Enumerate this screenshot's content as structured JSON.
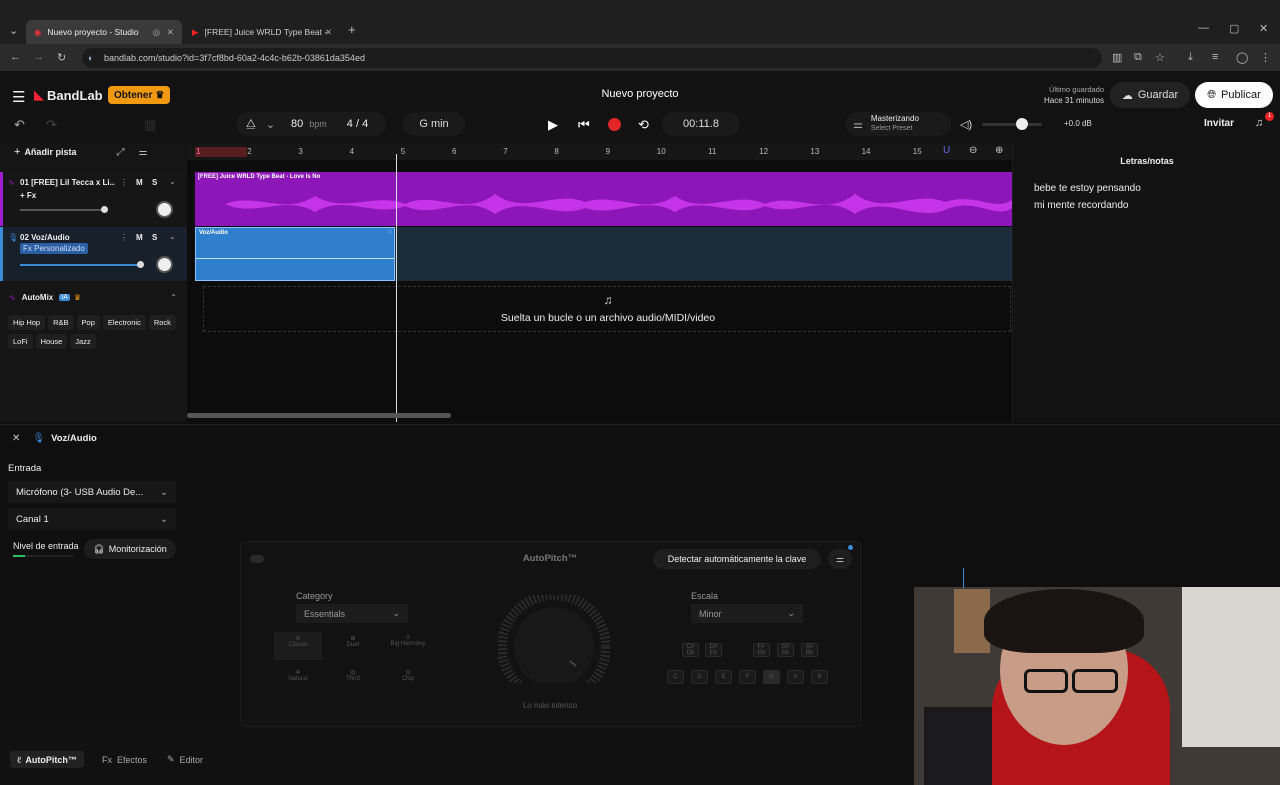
{
  "browser": {
    "tabs": [
      {
        "label": "Nuevo proyecto - Studio"
      },
      {
        "label": "[FREE] Juice WRLD Type Beat - "
      }
    ],
    "url": "bandlab.com/studio?id=3f7cf8bd-60a2-4c4c-b62b-03861da354ed"
  },
  "app": {
    "brand": "BandLab",
    "get_button": "Obtener",
    "project_title": "Nuevo proyecto",
    "tempo": "80",
    "tempo_unit": "bpm",
    "time_sig": "4 / 4",
    "key": "G min",
    "time": "00:11.8",
    "mastering_title": "Masterizando",
    "mastering_preset": "Select Preset",
    "volume_db": "+0.0 dB",
    "last_saved_label": "Último guardado",
    "last_saved_value": "Hace 31 minutos",
    "save_button": "Guardar",
    "publish_button": "Publicar",
    "invite_button": "Invitar",
    "notification_count": "1"
  },
  "tracks_panel": {
    "add_track": "Añadir pista",
    "tracks": [
      {
        "name": "01  [FREE] Lil Tecca x Li...",
        "fx": "+ Fx",
        "mute": "M",
        "solo": "S"
      },
      {
        "name": "02  Voz/Audio",
        "fx": "Fx Personalizado",
        "mute": "M",
        "solo": "S"
      }
    ],
    "automix_label": "AutoMix",
    "automix_badge": "IA",
    "genres_row1": [
      "Hip Hop",
      "R&B",
      "Pop",
      "Electronic",
      "Rock"
    ],
    "genres_row2": [
      "LoFi",
      "House",
      "Jazz"
    ]
  },
  "ruler": {
    "bars": [
      "1",
      "2",
      "3",
      "4",
      "5",
      "6",
      "7",
      "8",
      "9",
      "10",
      "11",
      "12",
      "13",
      "14",
      "15"
    ]
  },
  "timeline": {
    "clip1_label": "[FREE] Juice WRLD Type Beat - Love Is No",
    "clip2_label": "Voz/Audio",
    "drop_text": "Suelta un bucle o un archivo audio/MIDI/video"
  },
  "lyrics": {
    "title": "Letras/notas",
    "lines": [
      "bebe te estoy pensando",
      "mi mente recordando"
    ]
  },
  "bottom": {
    "track_name": "Voz/Audio",
    "input_label": "Entrada",
    "input_device": "Micrófono (3- USB Audio De...",
    "channel": "Canal 1",
    "level_label": "Nivel de entrada",
    "monitoring": "Monitorización",
    "autopitch_title": "AutoPitch™",
    "detect_key": "Detectar automáticamente la clave",
    "category_label": "Category",
    "category_value": "Essentials",
    "scale_label": "Escala",
    "scale_value": "Minor",
    "knob_label": "Lo más intenso",
    "presets": [
      "Classic",
      "Duet",
      "Big Harmony",
      "Natural",
      "Third",
      "Chip"
    ],
    "keys_sharp": [
      "C#\nDb",
      "D#\nEb",
      "F#\nGb",
      "G#\nAb",
      "A#\nBb"
    ],
    "keys": [
      "C",
      "D",
      "E",
      "F",
      "G",
      "A",
      "B"
    ],
    "tabs": [
      "AutoPitch™",
      "Efectos",
      "Editor"
    ],
    "tabs_prefix": [
      "",
      "Fx",
      ""
    ]
  },
  "colors": {
    "accent_purple": "#a21ad0",
    "audio_blue": "#3a8bd6",
    "record_red": "#e22626",
    "get_orange": "#f29a0f"
  }
}
